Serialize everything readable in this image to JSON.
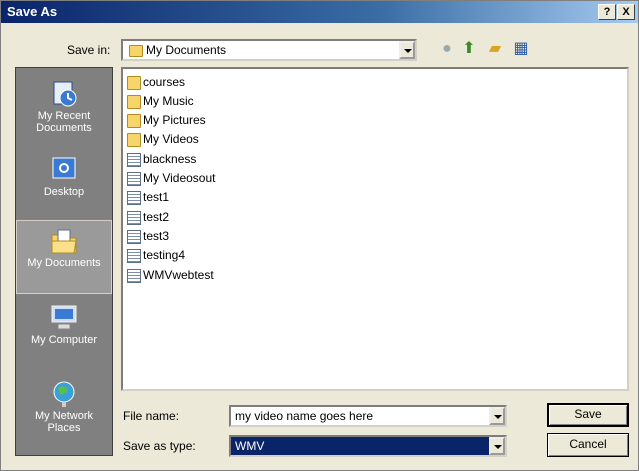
{
  "window": {
    "title": "Save As",
    "help_label": "?",
    "close_label": "X"
  },
  "save_in": {
    "label": "Save in:",
    "value": "My Documents"
  },
  "places": [
    {
      "label_1": "My Recent",
      "label_2": "Documents"
    },
    {
      "label_1": "Desktop",
      "label_2": ""
    },
    {
      "label_1": "My Documents",
      "label_2": ""
    },
    {
      "label_1": "My Computer",
      "label_2": ""
    },
    {
      "label_1": "My Network",
      "label_2": "Places"
    }
  ],
  "files": [
    {
      "name": "courses",
      "type": "folder"
    },
    {
      "name": "My Music",
      "type": "folder"
    },
    {
      "name": "My Pictures",
      "type": "folder"
    },
    {
      "name": "My Videos",
      "type": "folder"
    },
    {
      "name": "blackness",
      "type": "file"
    },
    {
      "name": "My Videosout",
      "type": "file"
    },
    {
      "name": "test1",
      "type": "file"
    },
    {
      "name": "test2",
      "type": "file"
    },
    {
      "name": "test3",
      "type": "file"
    },
    {
      "name": "testing4",
      "type": "file"
    },
    {
      "name": "WMVwebtest",
      "type": "file"
    }
  ],
  "file_name": {
    "label": "File name:",
    "value": "my video name goes here"
  },
  "save_as_type": {
    "label": "Save as type:",
    "value": "WMV"
  },
  "buttons": {
    "save": "Save",
    "cancel": "Cancel"
  }
}
